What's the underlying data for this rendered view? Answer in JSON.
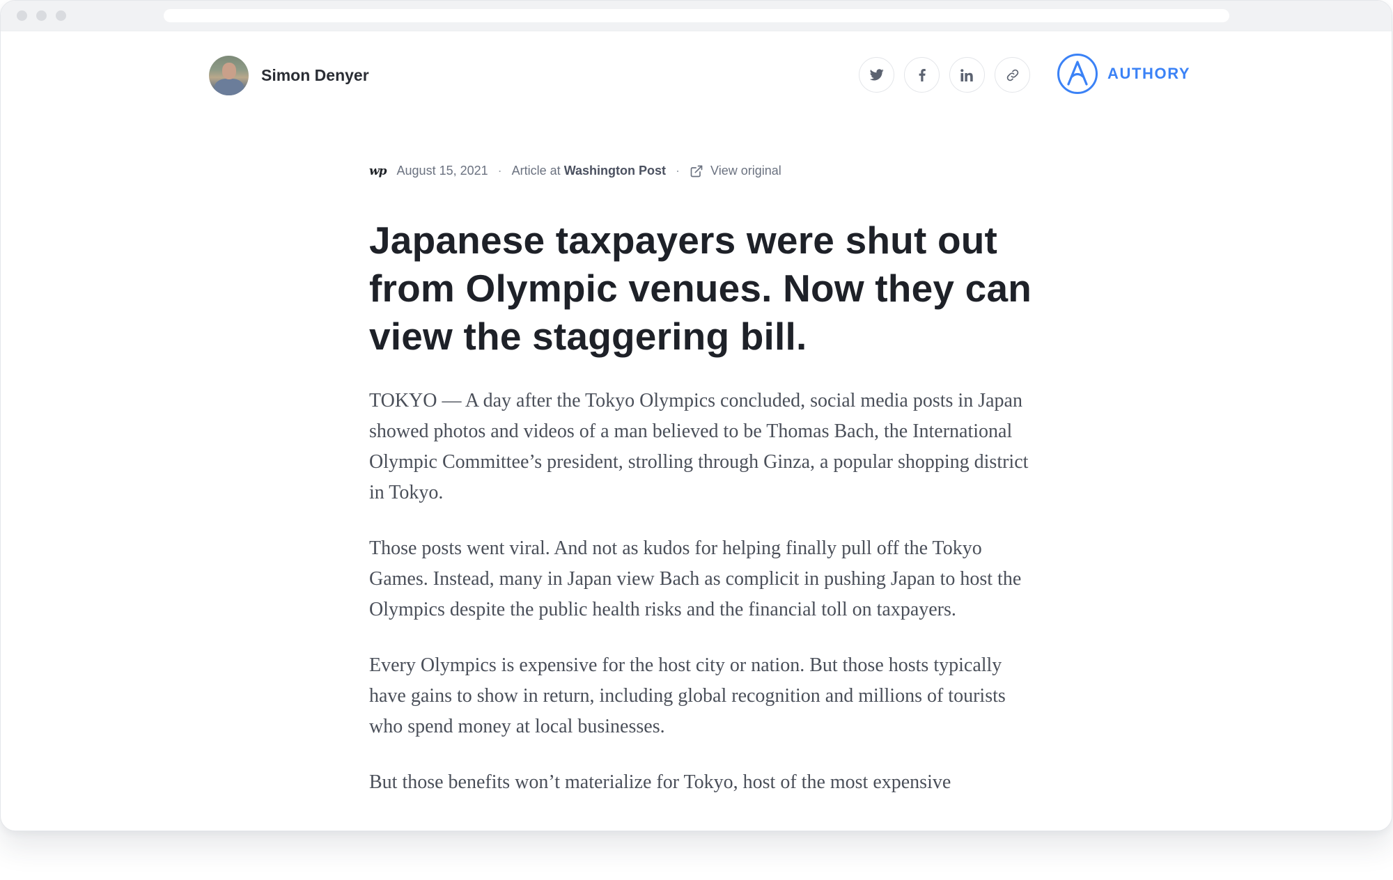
{
  "author": {
    "name": "Simon Denyer"
  },
  "share": {
    "icons": [
      "twitter-icon",
      "facebook-icon",
      "linkedin-icon",
      "link-icon"
    ]
  },
  "brand": {
    "name": "AUTHORY",
    "color": "#3b82f6"
  },
  "meta": {
    "publication_logo": "wp",
    "date": "August 15, 2021",
    "article_prefix": "Article at",
    "publication": "Washington Post",
    "view_original": "View original"
  },
  "article": {
    "headline": "Japanese taxpayers were shut out from Olympic venues. Now they can view the staggering bill.",
    "paragraphs": [
      "TOKYO — A day after the Tokyo Olympics concluded, social media posts in Japan showed photos and videos of a man believed to be Thomas Bach, the International Olympic Committee’s president, strolling through Ginza, a popular shopping district in Tokyo.",
      "Those posts went viral. And not as kudos for helping finally pull off the Tokyo Games. Instead, many in Japan view Bach as complicit in pushing Japan to host the Olympics despite the public health risks and the financial toll on taxpayers.",
      "Every Olympics is expensive for the host city or nation. But those hosts typically have gains to show in return, including global recognition and millions of tourists who spend money at local businesses.",
      "But those benefits won’t materialize for Tokyo, host of the most expensive"
    ]
  }
}
